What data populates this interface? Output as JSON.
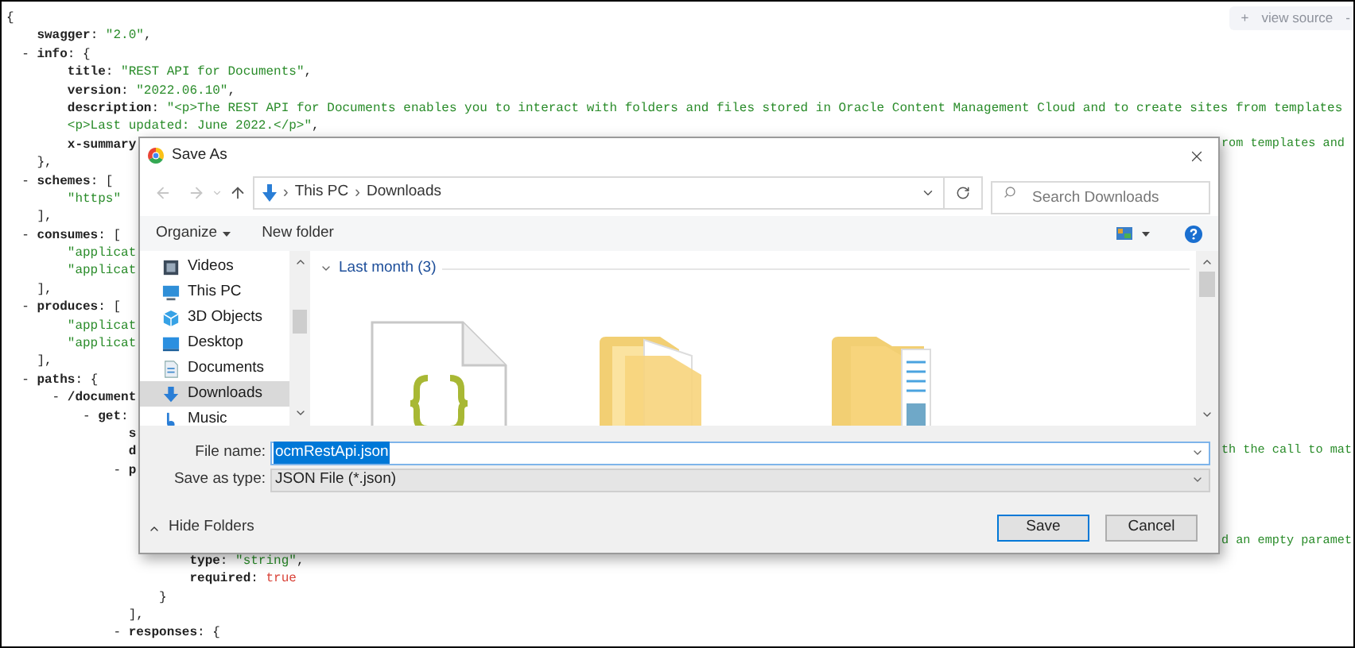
{
  "view_source": {
    "plus": "+",
    "label": "view source",
    "minus": "-"
  },
  "code_lines": [
    {
      "tokens": [
        {
          "kind": "p",
          "text": "{"
        }
      ]
    },
    {
      "tokens": [
        {
          "kind": "k",
          "text": "    swagger"
        },
        {
          "kind": "p",
          "text": ": "
        },
        {
          "kind": "s",
          "text": "\"2.0\""
        },
        {
          "kind": "p",
          "text": ","
        }
      ]
    },
    {
      "tokens": [
        {
          "kind": "p",
          "text": "  - "
        },
        {
          "kind": "k",
          "text": "info"
        },
        {
          "kind": "p",
          "text": ": {"
        }
      ]
    },
    {
      "tokens": [
        {
          "kind": "k",
          "text": "        title"
        },
        {
          "kind": "p",
          "text": ": "
        },
        {
          "kind": "s",
          "text": "\"REST API for Documents\""
        },
        {
          "kind": "p",
          "text": ","
        }
      ]
    },
    {
      "tokens": [
        {
          "kind": "k",
          "text": "        version"
        },
        {
          "kind": "p",
          "text": ": "
        },
        {
          "kind": "s",
          "text": "\"2022.06.10\""
        },
        {
          "kind": "p",
          "text": ","
        }
      ]
    },
    {
      "tokens": [
        {
          "kind": "k",
          "text": "        description"
        },
        {
          "kind": "p",
          "text": ": "
        },
        {
          "kind": "s",
          "text": "\"<p>The REST API for Documents enables you to interact with folders and files stored in Oracle Content Management Cloud and to create sites from templates"
        }
      ]
    },
    {
      "tokens": [
        {
          "kind": "s",
          "text": "        <p>Last updated: June 2022.</p>\""
        },
        {
          "kind": "p",
          "text": ","
        }
      ]
    },
    {
      "tokens": [
        {
          "kind": "k",
          "text": "        x-summary"
        }
      ],
      "right": "rom templates and"
    },
    {
      "tokens": [
        {
          "kind": "p",
          "text": "    },"
        }
      ]
    },
    {
      "tokens": [
        {
          "kind": "p",
          "text": "  - "
        },
        {
          "kind": "k",
          "text": "schemes"
        },
        {
          "kind": "p",
          "text": ": ["
        }
      ]
    },
    {
      "tokens": [
        {
          "kind": "s",
          "text": "        \"https\""
        }
      ]
    },
    {
      "tokens": [
        {
          "kind": "p",
          "text": "    ],"
        }
      ]
    },
    {
      "tokens": [
        {
          "kind": "p",
          "text": "  - "
        },
        {
          "kind": "k",
          "text": "consumes"
        },
        {
          "kind": "p",
          "text": ": ["
        }
      ]
    },
    {
      "tokens": [
        {
          "kind": "s",
          "text": "        \"applicat"
        }
      ]
    },
    {
      "tokens": [
        {
          "kind": "s",
          "text": "        \"applicat"
        }
      ]
    },
    {
      "tokens": [
        {
          "kind": "p",
          "text": "    ],"
        }
      ]
    },
    {
      "tokens": [
        {
          "kind": "p",
          "text": "  - "
        },
        {
          "kind": "k",
          "text": "produces"
        },
        {
          "kind": "p",
          "text": ": ["
        }
      ]
    },
    {
      "tokens": [
        {
          "kind": "s",
          "text": "        \"applicat"
        }
      ]
    },
    {
      "tokens": [
        {
          "kind": "s",
          "text": "        \"applicat"
        }
      ]
    },
    {
      "tokens": [
        {
          "kind": "p",
          "text": "    ],"
        }
      ]
    },
    {
      "tokens": [
        {
          "kind": "p",
          "text": "  - "
        },
        {
          "kind": "k",
          "text": "paths"
        },
        {
          "kind": "p",
          "text": ": {"
        }
      ]
    },
    {
      "tokens": [
        {
          "kind": "p",
          "text": "      - "
        },
        {
          "kind": "k",
          "text": "/document"
        }
      ]
    },
    {
      "tokens": [
        {
          "kind": "p",
          "text": "          - "
        },
        {
          "kind": "k",
          "text": "get"
        },
        {
          "kind": "p",
          "text": ":"
        }
      ]
    },
    {
      "tokens": [
        {
          "kind": "k",
          "text": "                s"
        }
      ]
    },
    {
      "tokens": [
        {
          "kind": "k",
          "text": "                d"
        }
      ],
      "right": "th the call to mat"
    },
    {
      "tokens": [
        {
          "kind": "p",
          "text": "              - "
        },
        {
          "kind": "k",
          "text": "p"
        }
      ]
    },
    {
      "right": "d an empty paramet"
    },
    {
      "tokens": [
        {
          "kind": "k",
          "text": "                        type"
        },
        {
          "kind": "p",
          "text": ": "
        },
        {
          "kind": "s",
          "text": "\"string\""
        },
        {
          "kind": "p",
          "text": ","
        }
      ]
    },
    {
      "tokens": [
        {
          "kind": "k",
          "text": "                        required"
        },
        {
          "kind": "p",
          "text": ": "
        },
        {
          "kind": "b",
          "text": "true"
        }
      ]
    },
    {
      "tokens": [
        {
          "kind": "p",
          "text": "                    }"
        }
      ]
    },
    {
      "tokens": [
        {
          "kind": "p",
          "text": "                ],"
        }
      ]
    },
    {
      "tokens": [
        {
          "kind": "p",
          "text": "              - "
        },
        {
          "kind": "k",
          "text": "responses"
        },
        {
          "kind": "p",
          "text": ": {"
        }
      ]
    }
  ],
  "dialog": {
    "title": "Save As",
    "address": {
      "crumbs": [
        {
          "separator": "›",
          "label": "This PC"
        },
        {
          "separator": "›",
          "label": "Downloads"
        }
      ]
    },
    "search": {
      "placeholder": "Search Downloads"
    },
    "toolbar": {
      "organize": "Organize",
      "new_folder": "New folder"
    },
    "nav_tree": [
      {
        "children": [
          {
            "label": "Videos",
            "kind": "video",
            "selected": false
          }
        ]
      },
      {
        "label": "This PC",
        "kind": "pc",
        "selected": false,
        "children": [
          {
            "label": "3D Objects",
            "kind": "cube",
            "selected": false
          },
          {
            "label": "Desktop",
            "kind": "desktop",
            "selected": false
          },
          {
            "label": "Documents",
            "kind": "docs",
            "selected": false
          },
          {
            "label": "Downloads",
            "kind": "download",
            "selected": true
          },
          {
            "label": "Music",
            "kind": "music",
            "selected": false
          }
        ]
      }
    ],
    "group": "Last month (3)",
    "files": [
      {
        "kind": "json-file"
      },
      {
        "kind": "folder"
      },
      {
        "kind": "folder-docs"
      }
    ],
    "file_name": {
      "label": "File name:",
      "value": "ocmRestApi.json",
      "selected": true
    },
    "save_type": {
      "label": "Save as type:",
      "value": "JSON File (*.json)"
    },
    "hide_folders": "Hide Folders",
    "buttons": [
      {
        "label": "Save",
        "default": true
      },
      {
        "label": "Cancel",
        "default": false
      }
    ]
  }
}
